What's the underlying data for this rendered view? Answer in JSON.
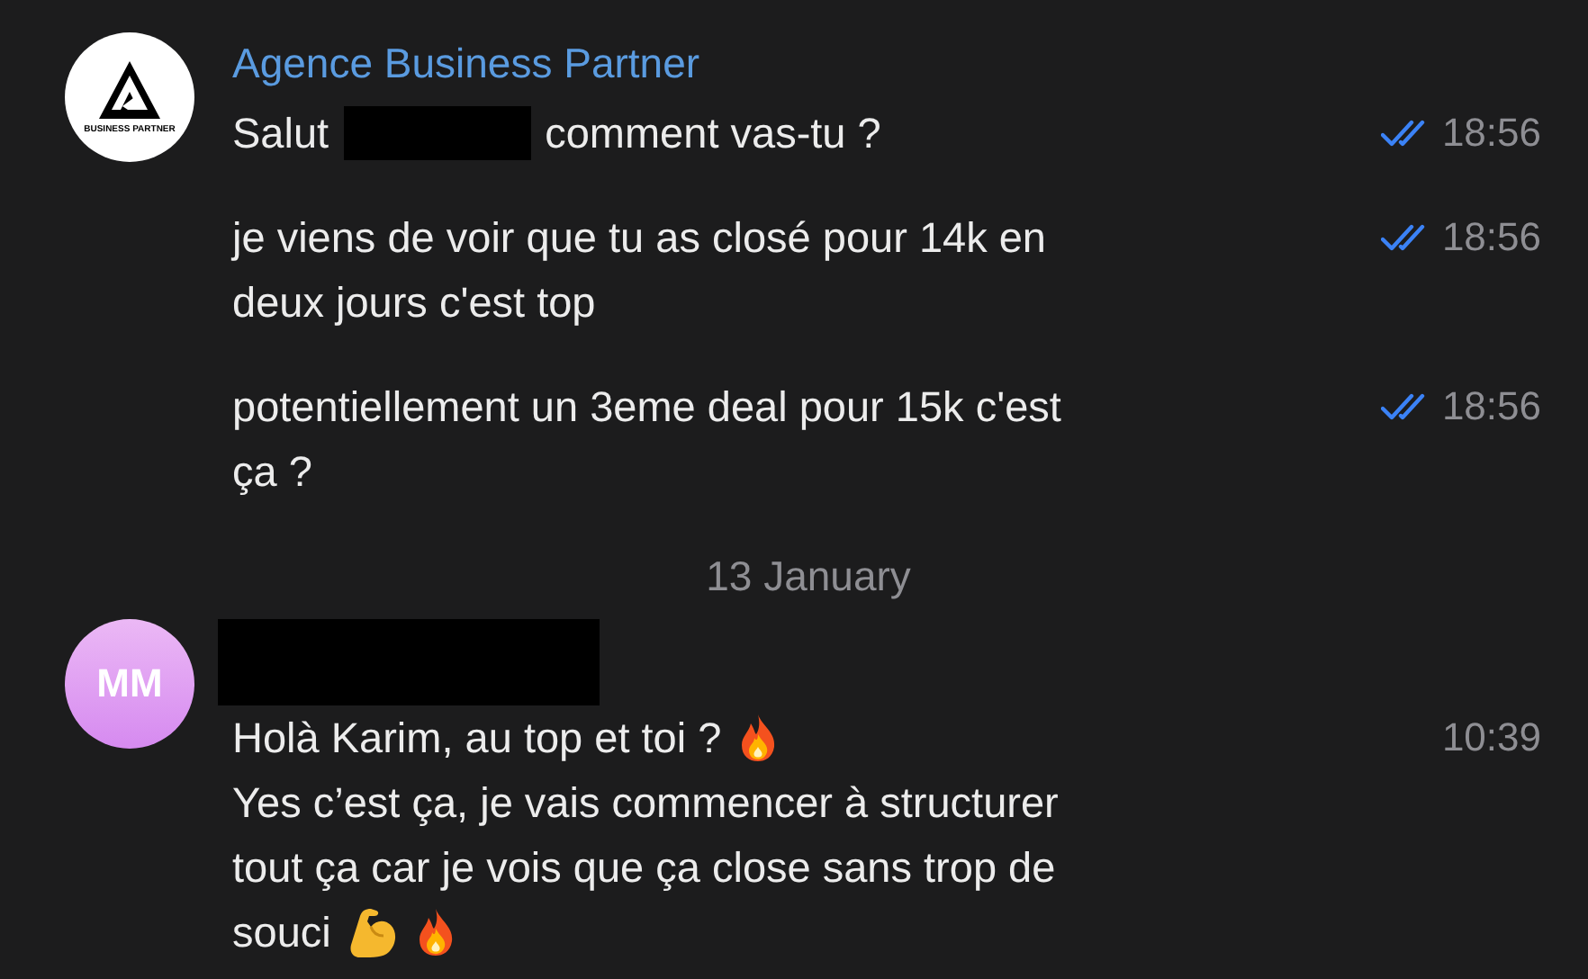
{
  "groups": [
    {
      "avatar": {
        "kind": "logo",
        "text": "BUSINESS PARTNER"
      },
      "sender": {
        "kind": "text",
        "text": "Agence Business Partner"
      },
      "messages": [
        {
          "time": "18:56",
          "read": true,
          "lines": [
            [
              {
                "kind": "text",
                "text": "Salut"
              },
              {
                "kind": "redacted"
              },
              {
                "kind": "text",
                "text": "comment vas-tu ?"
              }
            ]
          ]
        },
        {
          "time": "18:56",
          "read": true,
          "lines": [
            [
              {
                "kind": "text",
                "text": "je viens de voir que tu as closé pour 14k en"
              }
            ],
            [
              {
                "kind": "text",
                "text": "deux jours c'est top"
              }
            ]
          ]
        },
        {
          "time": "18:56",
          "read": true,
          "lines": [
            [
              {
                "kind": "text",
                "text": "potentiellement un 3eme deal pour 15k c'est"
              }
            ],
            [
              {
                "kind": "text",
                "text": "ça ?"
              }
            ]
          ]
        }
      ]
    },
    {
      "date": "13 January"
    },
    {
      "avatar": {
        "kind": "initials",
        "text": "MM"
      },
      "sender": {
        "kind": "redacted"
      },
      "messages": [
        {
          "time": "10:39",
          "read": false,
          "lines": [
            [
              {
                "kind": "text",
                "text": "Holà Karim, au top et toi ?"
              },
              {
                "kind": "flame"
              }
            ],
            [
              {
                "kind": "text",
                "text": "Yes c’est ça, je vais commencer à structurer"
              }
            ],
            [
              {
                "kind": "text",
                "text": "tout ça car je vois que ça close sans trop de"
              }
            ],
            [
              {
                "kind": "text",
                "text": "souci"
              },
              {
                "kind": "arm"
              },
              {
                "kind": "flame"
              }
            ]
          ]
        }
      ]
    }
  ]
}
